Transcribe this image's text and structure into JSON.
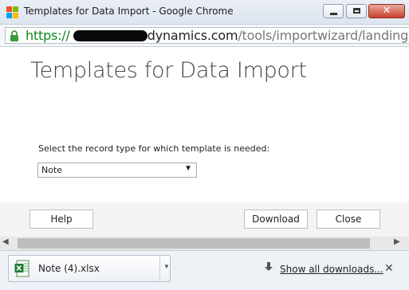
{
  "window": {
    "title": "Templates for Data Import - Google Chrome",
    "controls": {
      "minimize_icon": "minimize-icon",
      "maximize_icon": "maximize-icon",
      "close_glyph": "✕"
    }
  },
  "address_bar": {
    "scheme": "https://",
    "host": "dynamics.com",
    "path": "/tools/importwizard/landingpage",
    "secure_color": "#0b8a1a"
  },
  "page": {
    "title": "Templates for Data Import",
    "record_type_label": "Select the record type for which template is needed:",
    "record_type_selected": "Note",
    "buttons": {
      "help": "Help",
      "download": "Download",
      "close": "Close"
    }
  },
  "downloads": {
    "item_name": "Note (4).xlsx",
    "show_all": "Show all downloads...",
    "close_glyph": "✕"
  },
  "icons": {
    "app": "chrome-windows-logo-icon",
    "lock": "lock-icon",
    "file": "excel-file-icon",
    "download": "download-arrow-icon"
  }
}
